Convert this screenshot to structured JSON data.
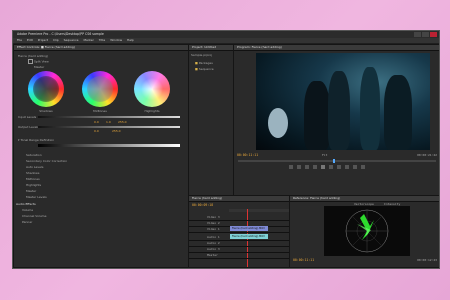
{
  "window": {
    "title": "Adobe Premiere Pro - C:\\Users\\Desktop\\PP CS6 sample",
    "menus": [
      "File",
      "Edit",
      "Project",
      "Clip",
      "Sequence",
      "Marker",
      "Title",
      "Window",
      "Help"
    ]
  },
  "effect_controls": {
    "tab": "Effect Controls: ■ Fierce (hard adding)",
    "effect_name": "Fierce (hard adding)",
    "toggle_label": "Split View",
    "master_label": "Master",
    "wheels": [
      "Shadows",
      "Midtones",
      "Highlights"
    ],
    "input_levels_label": "Input Levels",
    "output_levels_label": "Output Levels",
    "levels_values": [
      "0.0",
      "1.0",
      "255.0"
    ],
    "output_values": [
      "0.0",
      "255.0"
    ],
    "lower_label": "Tonal Range Definition",
    "sub_rows": [
      "Saturation",
      "Secondary Color Correction",
      "Auto Levels",
      "Shadows",
      "Midtones",
      "Highlights",
      "Master",
      "Master Levels"
    ],
    "audio_header": "Audio Effects",
    "audio_rows": [
      "Volume",
      "Channel Volume",
      "Panner"
    ]
  },
  "project": {
    "tab": "Project: Untitled",
    "items_label": "Sample.prproj",
    "folders": [
      "Packages",
      "Sequence"
    ]
  },
  "program": {
    "tab": "Program: Fierce (hard adding)",
    "timecode_left": "00:00:11:11",
    "timecode_right": "00:00:21:22",
    "fit_label": "Fit"
  },
  "timeline": {
    "tab": "Fierce (hard adding)",
    "timecode": "00:00:09:18",
    "video_tracks": [
      "Video 3",
      "Video 2",
      "Video 1"
    ],
    "audio_tracks": [
      "Audio 1",
      "Audio 2",
      "Audio 3"
    ],
    "master_label": "Master",
    "video_clip": "Fierce (hard adding).MOV",
    "audio_clip": "Fierce (hard adding).MOV"
  },
  "source": {
    "tab": "Reference: Fierce (hard adding)",
    "timecode_left": "00:00:11:11",
    "timecode_right": "00:00:12:23",
    "scope_label": "Vectorscope",
    "intensity_label": "Intensity"
  },
  "colors": {
    "accent_timecode": "#e9a83a",
    "video_clip": "#7f8ad6",
    "audio_clip": "#7fd1d6",
    "vectorscope_trace": "#33ff33"
  }
}
